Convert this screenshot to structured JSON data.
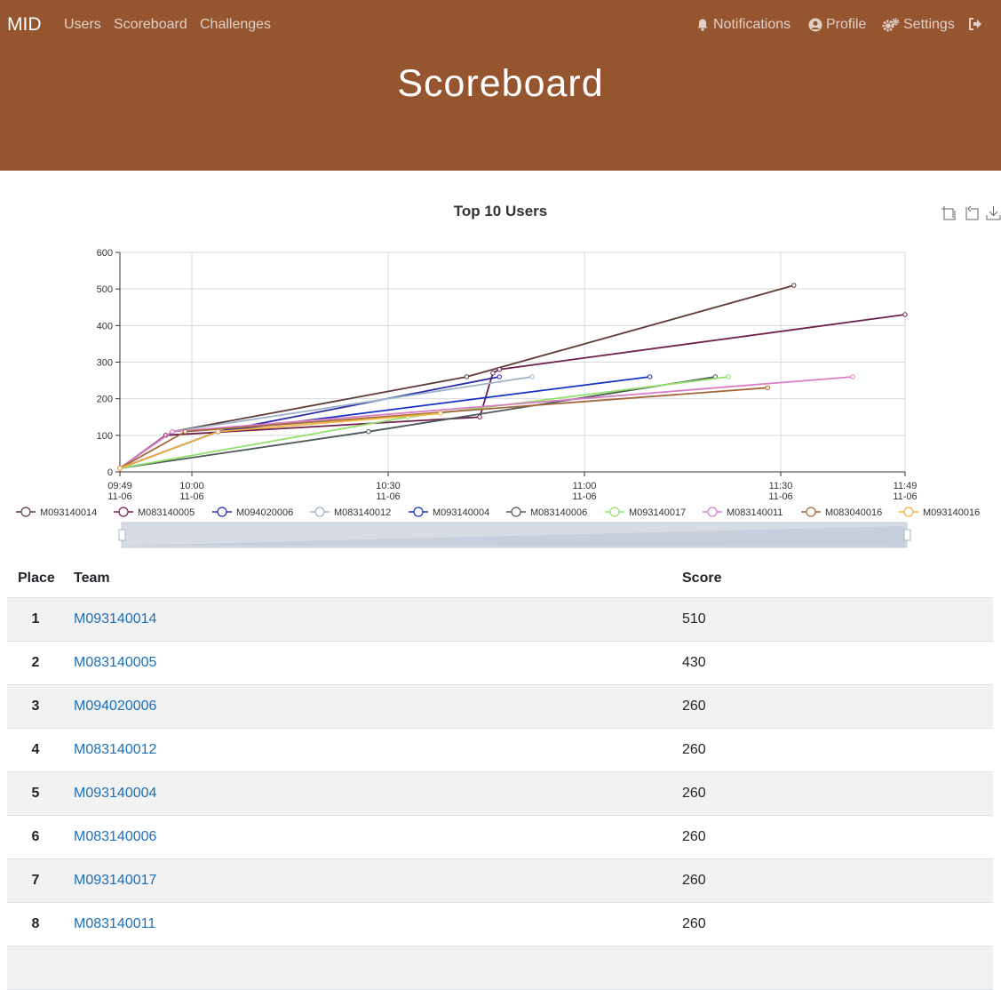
{
  "nav": {
    "brand": "MID",
    "links": [
      "Users",
      "Scoreboard",
      "Challenges"
    ],
    "right": [
      "Notifications",
      "Profile",
      "Settings"
    ]
  },
  "hero": {
    "title": "Scoreboard"
  },
  "chart_data": {
    "type": "line",
    "title": "Top 10 Users",
    "xlabel": "",
    "ylabel": "",
    "ylim": [
      0,
      600
    ],
    "yticks": [
      0,
      100,
      200,
      300,
      400,
      500,
      600
    ],
    "xlim": [
      "09:49",
      "11:49"
    ],
    "xticks": [
      {
        "time": "09:49",
        "date": "11-06"
      },
      {
        "time": "10:00",
        "date": "11-06"
      },
      {
        "time": "10:30",
        "date": "11-06"
      },
      {
        "time": "11:00",
        "date": "11-06"
      },
      {
        "time": "11:30",
        "date": "11-06"
      },
      {
        "time": "11:49",
        "date": "11-06"
      }
    ],
    "grid": true,
    "legend": "bottom",
    "series": [
      {
        "name": "M093140014",
        "color": "#5d3a35",
        "points": [
          [
            "09:49",
            10
          ],
          [
            "09:57",
            110
          ],
          [
            "10:42",
            260
          ],
          [
            "11:32",
            510
          ]
        ]
      },
      {
        "name": "M083140005",
        "color": "#6e1f4c",
        "points": [
          [
            "09:49",
            10
          ],
          [
            "09:56",
            100
          ],
          [
            "10:44",
            150
          ],
          [
            "10:46",
            270
          ],
          [
            "10:47",
            280
          ],
          [
            "11:49",
            430
          ]
        ]
      },
      {
        "name": "M094020006",
        "color": "#2a2aa8",
        "points": [
          [
            "09:49",
            10
          ],
          [
            "10:04",
            110
          ],
          [
            "10:47",
            260
          ]
        ]
      },
      {
        "name": "M083140012",
        "color": "#9fb3c8",
        "points": [
          [
            "09:49",
            10
          ],
          [
            "09:57",
            110
          ],
          [
            "10:52",
            260
          ]
        ]
      },
      {
        "name": "M093140004",
        "color": "#1233c2",
        "points": [
          [
            "09:49",
            10
          ],
          [
            "10:04",
            110
          ],
          [
            "11:10",
            260
          ]
        ]
      },
      {
        "name": "M083140006",
        "color": "#4c5858",
        "points": [
          [
            "09:49",
            10
          ],
          [
            "10:27",
            110
          ],
          [
            "11:20",
            260
          ]
        ]
      },
      {
        "name": "M093140017",
        "color": "#90e06a",
        "points": [
          [
            "09:49",
            10
          ],
          [
            "10:33",
            150
          ],
          [
            "11:22",
            260
          ]
        ]
      },
      {
        "name": "M083140011",
        "color": "#d97cc4",
        "points": [
          [
            "09:49",
            10
          ],
          [
            "09:57",
            110
          ],
          [
            "11:41",
            260
          ]
        ]
      },
      {
        "name": "M083040016",
        "color": "#a3683a",
        "points": [
          [
            "09:49",
            10
          ],
          [
            "09:59",
            110
          ],
          [
            "11:28",
            230
          ]
        ]
      },
      {
        "name": "M093140016",
        "color": "#f2b03c",
        "points": [
          [
            "09:49",
            10
          ],
          [
            "10:04",
            110
          ],
          [
            "10:38",
            160
          ]
        ]
      }
    ]
  },
  "scoreboard": {
    "headers": {
      "place": "Place",
      "team": "Team",
      "score": "Score"
    },
    "rows": [
      {
        "place": "1",
        "team": "M093140014",
        "score": "510"
      },
      {
        "place": "2",
        "team": "M083140005",
        "score": "430"
      },
      {
        "place": "3",
        "team": "M094020006",
        "score": "260"
      },
      {
        "place": "4",
        "team": "M083140012",
        "score": "260"
      },
      {
        "place": "5",
        "team": "M093140004",
        "score": "260"
      },
      {
        "place": "6",
        "team": "M083140006",
        "score": "260"
      },
      {
        "place": "7",
        "team": "M093140017",
        "score": "260"
      },
      {
        "place": "8",
        "team": "M083140011",
        "score": "260"
      }
    ]
  }
}
